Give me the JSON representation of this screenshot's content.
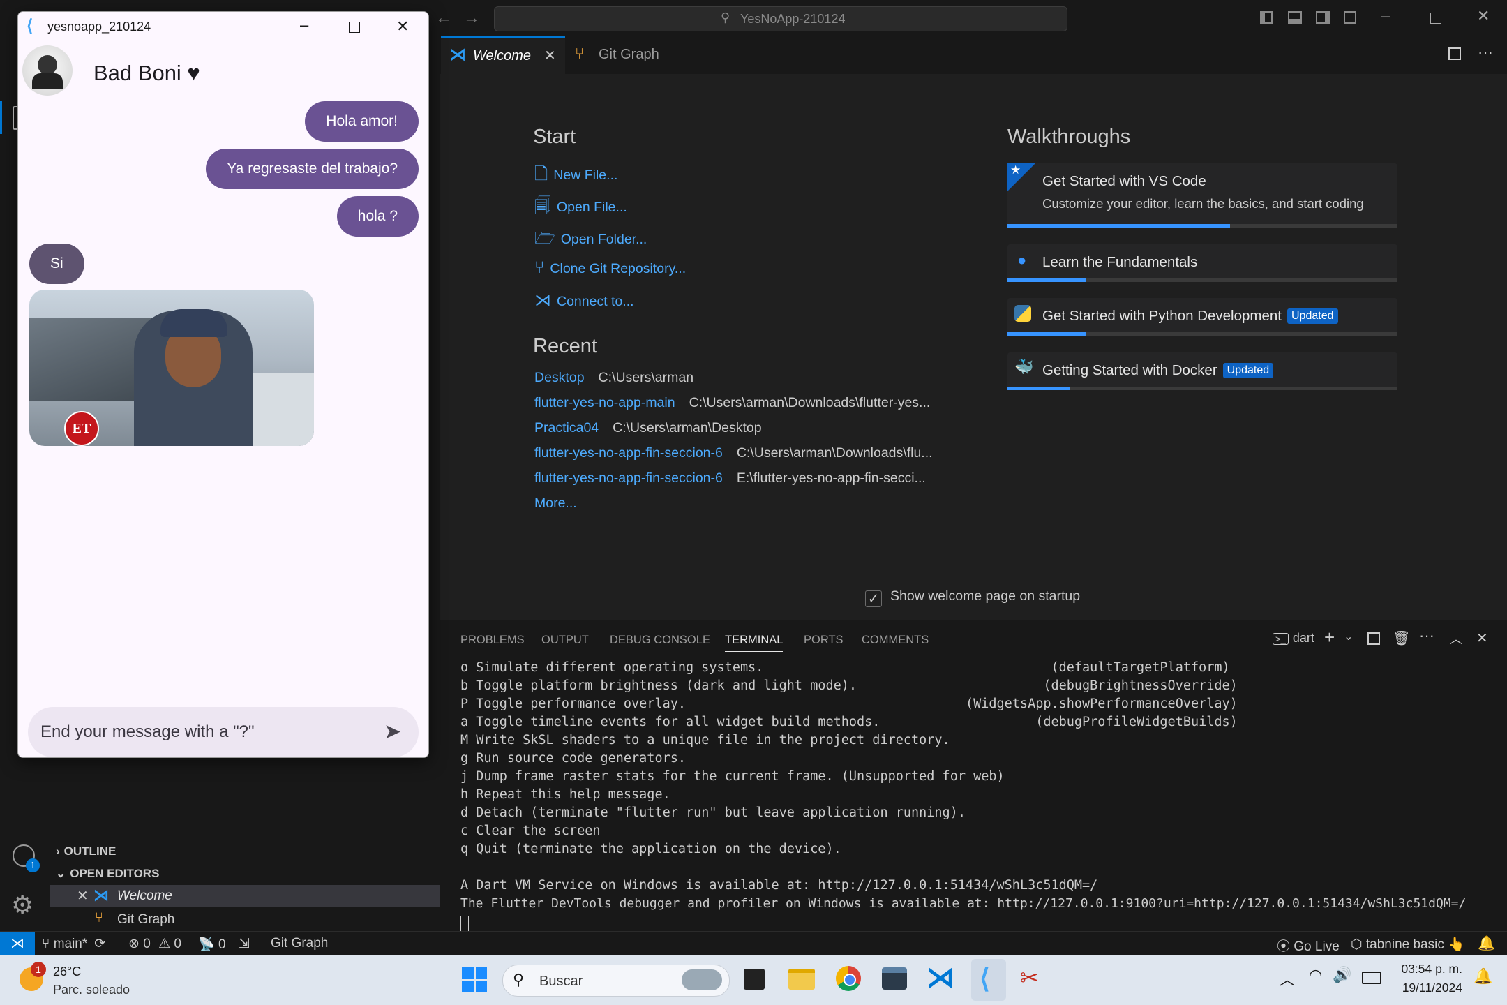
{
  "app_window": {
    "title": "yesnoapp_210124",
    "contact_name": "Bad Boni ♥",
    "messages": [
      {
        "from": "me",
        "text": "Hola amor!"
      },
      {
        "from": "me",
        "text": "Ya regresaste del trabajo?"
      },
      {
        "from": "me",
        "text": "hola ?"
      },
      {
        "from": "her",
        "text": "Si"
      }
    ],
    "gif_logo": "ET",
    "input_placeholder": "End your message with a \"?\""
  },
  "vscode": {
    "search": "YesNoApp-210124",
    "tabs": [
      {
        "label": "Welcome",
        "active": true
      },
      {
        "label": "Git Graph",
        "active": false
      }
    ],
    "welcome": {
      "start_title": "Start",
      "start_items": [
        "New File...",
        "Open File...",
        "Open Folder...",
        "Clone Git Repository...",
        "Connect to..."
      ],
      "recent_title": "Recent",
      "recent": [
        {
          "name": "Desktop",
          "path": "C:\\Users\\arman"
        },
        {
          "name": "flutter-yes-no-app-main",
          "path": "C:\\Users\\arman\\Downloads\\flutter-yes..."
        },
        {
          "name": "Practica04",
          "path": "C:\\Users\\arman\\Desktop"
        },
        {
          "name": "flutter-yes-no-app-fin-seccion-6",
          "path": "C:\\Users\\arman\\Downloads\\flu..."
        },
        {
          "name": "flutter-yes-no-app-fin-seccion-6",
          "path": "E:\\flutter-yes-no-app-fin-secci..."
        }
      ],
      "more": "More...",
      "walkthroughs_title": "Walkthroughs",
      "walkthroughs": [
        {
          "title": "Get Started with VS Code",
          "desc": "Customize your editor, learn the basics, and start coding",
          "badge": "",
          "progress": 0.57
        },
        {
          "title": "Learn the Fundamentals",
          "desc": "",
          "badge": "",
          "progress": 0.2
        },
        {
          "title": "Get Started with Python Development",
          "desc": "",
          "badge": "Updated",
          "progress": 0.2
        },
        {
          "title": "Getting Started with Docker",
          "desc": "",
          "badge": "Updated",
          "progress": 0.16
        }
      ],
      "show_on_startup": "Show welcome page on startup"
    },
    "panel": {
      "tabs": [
        "PROBLEMS",
        "OUTPUT",
        "DEBUG CONSOLE",
        "TERMINAL",
        "PORTS",
        "COMMENTS"
      ],
      "active_tab": "TERMINAL",
      "terminal_name": "dart",
      "lines": [
        "o Simulate different operating systems.                                     (defaultTargetPlatform)",
        "b Toggle platform brightness (dark and light mode).                        (debugBrightnessOverride)",
        "P Toggle performance overlay.                                    (WidgetsApp.showPerformanceOverlay)",
        "a Toggle timeline events for all widget build methods.                    (debugProfileWidgetBuilds)",
        "M Write SkSL shaders to a unique file in the project directory.",
        "g Run source code generators.",
        "j Dump frame raster stats for the current frame. (Unsupported for web)",
        "h Repeat this help message.",
        "d Detach (terminate \"flutter run\" but leave application running).",
        "c Clear the screen",
        "q Quit (terminate the application on the device).",
        "",
        "A Dart VM Service on Windows is available at: http://127.0.0.1:51434/wShL3c51dQM=/",
        "The Flutter DevTools debugger and profiler on Windows is available at: http://127.0.0.1:9100?uri=http://127.0.0.1:51434/wShL3c51dQM=/"
      ]
    },
    "sidebar": {
      "outline": "OUTLINE",
      "open_editors": "OPEN EDITORS",
      "editors": [
        "Welcome",
        "Git Graph"
      ]
    },
    "accounts_badge": "1",
    "status": {
      "branch": "main*",
      "errors": "0",
      "warnings": "0",
      "ports": "0",
      "git_graph": "Git Graph",
      "go_live": "Go Live",
      "tabnine": "tabnine basic"
    }
  },
  "taskbar": {
    "weather_temp": "26°C",
    "weather_desc": "Parc. soleado",
    "weather_badge": "1",
    "search_placeholder": "Buscar",
    "time": "03:54 p. m.",
    "date": "19/11/2024"
  },
  "colors": {
    "accent": "#6a5293",
    "link": "#4daafc",
    "vscode_blue": "#0078d4"
  }
}
